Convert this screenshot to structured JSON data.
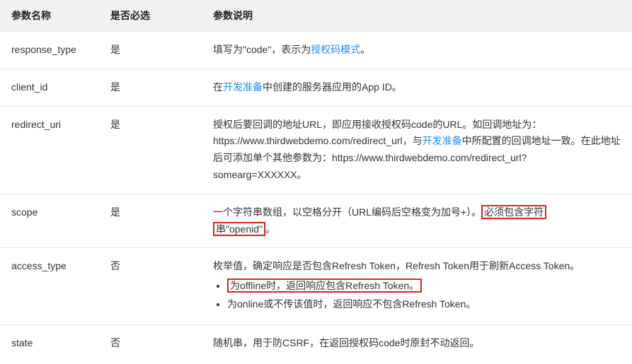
{
  "headers": {
    "name": "参数名称",
    "required": "是否必选",
    "desc": "参数说明"
  },
  "rows": {
    "response_type": {
      "name": "response_type",
      "required": "是",
      "desc_pre": "填写为\"code\"，表示为",
      "desc_link": "授权码模式",
      "desc_post": "。"
    },
    "client_id": {
      "name": "client_id",
      "required": "是",
      "desc_pre": "在",
      "desc_link": "开发准备",
      "desc_post": "中创建的服务器应用的App ID。"
    },
    "redirect_uri": {
      "name": "redirect_uri",
      "required": "是",
      "desc_pre": "授权后要回调的地址URL，即应用接收授权码code的URL。如回调地址为：https://www.thirdwebdemo.com/redirect_url，与",
      "desc_link": "开发准备",
      "desc_post": "中所配置的回调地址一致。在此地址后可添加单个其他参数为：https://www.thirdwebdemo.com/redirect_url?somearg=XXXXXX。"
    },
    "scope": {
      "name": "scope",
      "required": "是",
      "desc_pre": "一个字符串数组，以空格分开（URL编码后空格变为加号+）。",
      "hl1": "必须包含字符",
      "hl2": "串\"openid\"",
      "desc_post": "。"
    },
    "access_type": {
      "name": "access_type",
      "required": "否",
      "desc_line": "枚举值，确定响应是否包含Refresh Token，Refresh Token用于刷新Access Token。",
      "li1": "为offline时，返回响应包含Refresh Token。",
      "li2": "为online或不传该值时，返回响应不包含Refresh Token。"
    },
    "state": {
      "name": "state",
      "required": "否",
      "desc": "随机串，用于防CSRF，在返回授权码code时原封不动返回。"
    }
  }
}
